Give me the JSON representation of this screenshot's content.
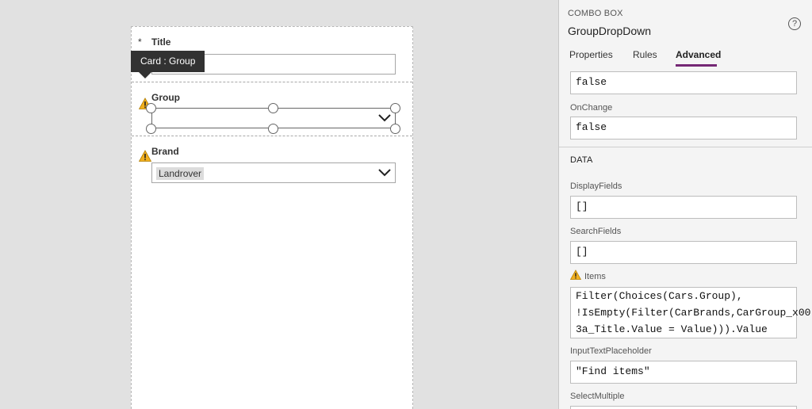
{
  "form": {
    "title_field": {
      "required_mark": "*",
      "label": "Title",
      "value": ""
    },
    "group_field": {
      "label": "Group",
      "value": ""
    },
    "brand_field": {
      "label": "Brand",
      "selected": "Landrover"
    },
    "tooltip": "Card : Group"
  },
  "panel": {
    "control_type": "COMBO BOX",
    "control_name": "GroupDropDown",
    "help_glyph": "?",
    "tabs": [
      {
        "label": "Properties",
        "active": false
      },
      {
        "label": "Rules",
        "active": false
      },
      {
        "label": "Advanced",
        "active": true
      }
    ],
    "top_value": "false",
    "onchange": {
      "label": "OnChange",
      "value": "false"
    },
    "data_section": "DATA",
    "display_fields": {
      "label": "DisplayFields",
      "value": "[]"
    },
    "search_fields": {
      "label": "SearchFields",
      "value": "[]"
    },
    "items": {
      "label": "Items",
      "value": "Filter(Choices(Cars.Group),\n!IsEmpty(Filter(CarBrands,CarGroup_x00\n3a_Title.Value = Value))).Value"
    },
    "input_placeholder": {
      "label": "InputTextPlaceholder",
      "value": "\"Find items\""
    },
    "select_multiple": {
      "label": "SelectMultiple"
    }
  },
  "colors": {
    "accent": "#742774",
    "warning": "#f2b01e",
    "tooltip_bg": "#323232"
  }
}
